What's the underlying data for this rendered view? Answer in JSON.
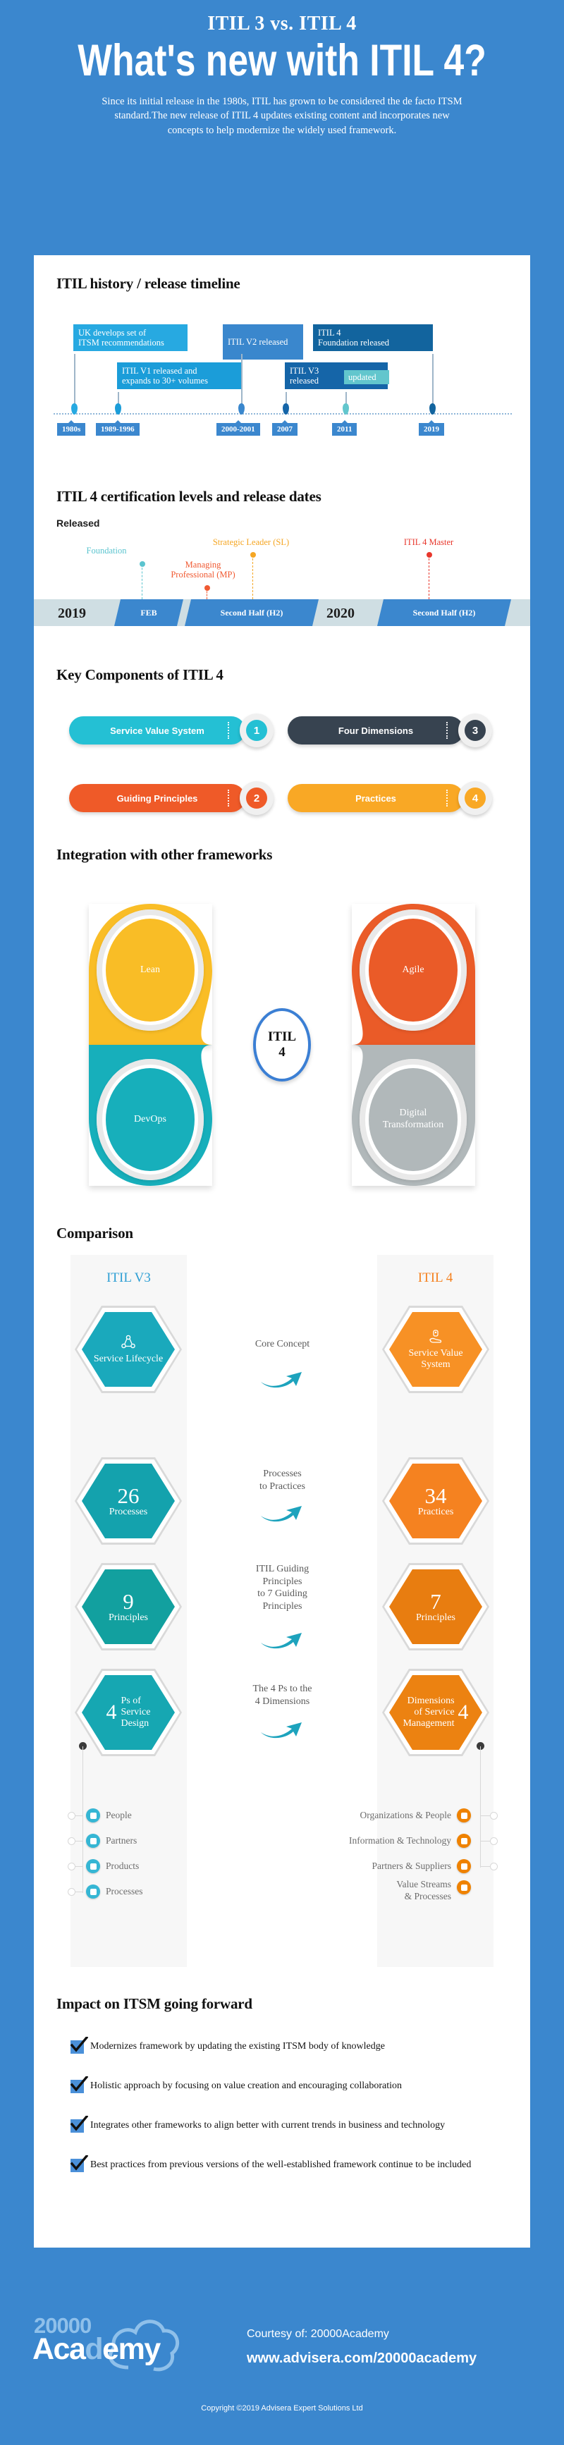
{
  "header": {
    "eyebrow": "ITIL 3 vs. ITIL 4",
    "title": "What's new with ITIL 4?",
    "intro": "Since its initial release in the 1980s, ITIL has grown to be considered the de facto ITSM standard.The new release of ITIL 4 updates existing content and incorporates new concepts to help modernize the widely used framework."
  },
  "timeline": {
    "title": "ITIL history / release timeline",
    "events": [
      {
        "label": "UK develops set of\nITSM recommendations",
        "year": "1980s",
        "color": "#27a9e1"
      },
      {
        "label": "ITIL V1 released and\nexpands to 30+ volumes",
        "year": "1989-1996",
        "color": "#1b9dd9"
      },
      {
        "label": "ITIL V2 released",
        "year": "2000-2001",
        "color": "#3a87cd"
      },
      {
        "label": "ITIL V3\nreleased",
        "year": "2007",
        "color": "#1565a8"
      },
      {
        "label": "updated",
        "year": "2011",
        "color": "#62c6cd"
      },
      {
        "label": "ITIL 4\nFoundation released",
        "year": "2019",
        "color": "#12649e"
      }
    ]
  },
  "certification": {
    "title": "ITIL 4 certification levels and release dates",
    "released_label": "Released",
    "levels": [
      {
        "name": "Foundation",
        "color": "#5bc4cf"
      },
      {
        "name": "Managing\nProfessional (MP)",
        "color": "#f05a32"
      },
      {
        "name": "Strategic Leader (SL)",
        "color": "#f5a623"
      },
      {
        "name": "ITIL 4 Master",
        "color": "#e8372c"
      }
    ],
    "axis": [
      {
        "year": "2019",
        "chips": [
          "FEB",
          "Second Half (H2)"
        ]
      },
      {
        "year": "2020",
        "chips": [
          "Second Half (H2)"
        ]
      }
    ]
  },
  "key_components": {
    "title": "Key Components of ITIL 4",
    "items": [
      {
        "label": "Service Value System",
        "number": "1",
        "color": "#24c0d4"
      },
      {
        "label": "Guiding Principles",
        "number": "2",
        "color": "#ef5a28"
      },
      {
        "label": "Four Dimensions",
        "number": "3",
        "color": "#374350"
      },
      {
        "label": "Practices",
        "number": "4",
        "color": "#f9a825"
      }
    ]
  },
  "integration": {
    "title": "Integration with other frameworks",
    "center_line1": "ITIL",
    "center_line2": "4",
    "petals": [
      {
        "label": "Lean",
        "color": "#f9bd26"
      },
      {
        "label": "Agile",
        "color": "#ea5b28"
      },
      {
        "label": "DevOps",
        "color": "#17afbb"
      },
      {
        "label": "Digital\nTransformation",
        "color": "#b1b8ba"
      }
    ]
  },
  "comparison": {
    "title": "Comparison",
    "left_header": {
      "text": "ITIL V3",
      "color": "#2e9fd4"
    },
    "right_header": {
      "text": "ITIL 4",
      "color": "#f58220"
    },
    "rows": [
      {
        "middle": "Core Concept",
        "left": {
          "big": "",
          "text": "Service Lifecycle",
          "icon": "share-nodes-icon"
        },
        "right": {
          "big": "",
          "text": "Service Value\nSystem",
          "icon": "hand-gear-icon"
        }
      },
      {
        "middle": "Processes\nto Practices",
        "left": {
          "big": "26",
          "text": "Processes"
        },
        "right": {
          "big": "34",
          "text": "Practices"
        }
      },
      {
        "middle": "ITIL Guiding\nPrinciples\nto 7 Guiding\nPrinciples",
        "left": {
          "big": "9",
          "text": "Principles"
        },
        "right": {
          "big": "7",
          "text": "Principles"
        }
      },
      {
        "middle": "The 4 Ps to the\n4 Dimensions",
        "left": {
          "big": "4",
          "text": "Ps of\nService\nDesign"
        },
        "right": {
          "big": "4",
          "text": "Dimensions\nof Service\nManagement"
        }
      }
    ],
    "left_bullets": [
      "People",
      "Partners",
      "Products",
      "Processes"
    ],
    "right_bullets": [
      "Organizations & People",
      "Information & Technology",
      "Partners & Suppliers",
      "Value Streams\n& Processes"
    ],
    "left_color": "#1aa3bd",
    "right_color": "#ef8200",
    "left_hex_colors": [
      "#1aa9bc",
      "#14a2ad",
      "#12a09f",
      "#16a7b2"
    ],
    "right_hex_colors": [
      "#f79125",
      "#f58220",
      "#e87d10",
      "#ec8211"
    ]
  },
  "impact": {
    "title": "Impact on ITSM going forward",
    "items": [
      "Modernizes framework by updating the existing ITSM body of knowledge",
      "Holistic approach by focusing on value creation and encouraging collaboration",
      "Integrates other frameworks to align better with current trends in business and technology",
      "Best practices from previous versions of the well-established framework continue to be included"
    ]
  },
  "footer": {
    "logo_top": "20000",
    "logo_bottom_a": "Aca",
    "logo_bottom_d": "d",
    "logo_bottom_emy": "emy",
    "courtesy": "Courtesy of: 20000Academy",
    "url": "www.advisera.com/20000academy",
    "copyright": "Copyright ©2019 Advisera Expert Solutions Ltd"
  }
}
